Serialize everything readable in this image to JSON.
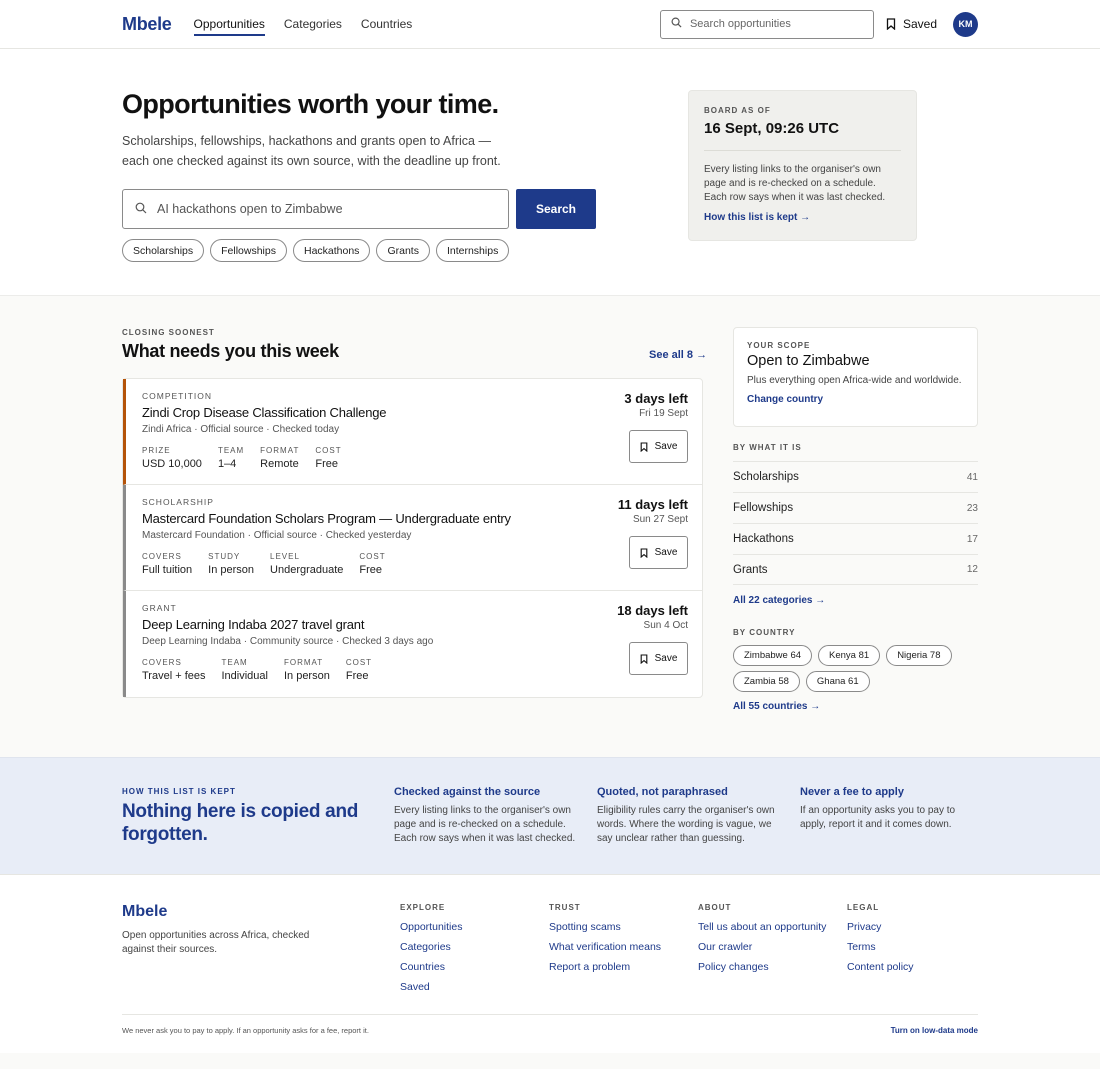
{
  "header": {
    "logo": "Mbele",
    "nav": [
      "Opportunities",
      "Categories",
      "Countries"
    ],
    "search_placeholder": "Search opportunities",
    "saved_label": "Saved",
    "avatar_initials": "KM"
  },
  "hero": {
    "title": "Opportunities worth your time.",
    "subtitle": "Scholarships, fellowships, hackathons and grants open to Africa — each one checked against its own source, with the deadline up front.",
    "search_placeholder": "AI hackathons open to Zimbabwe",
    "search_button": "Search",
    "chips": [
      "Scholarships",
      "Fellowships",
      "Hackathons",
      "Grants",
      "Internships"
    ]
  },
  "board": {
    "label": "BOARD AS OF",
    "value": "16 Sept, 09:26 UTC",
    "text": "Every listing links to the organiser's own page and is re-checked on a schedule. Each row says when it was last checked.",
    "link": "How this list is kept →"
  },
  "closing": {
    "eyebrow": "CLOSING SOONEST",
    "title": "What needs you this week",
    "see_all": "See all 8 →",
    "save_label": "Save",
    "cards": [
      {
        "type": "COMPETITION",
        "title": "Zindi Crop Disease Classification Challenge",
        "meta": "Zindi Africa · Official source · Checked today",
        "days": "3 days left",
        "date": "Fri 19 Sept",
        "facts": [
          {
            "k": "PRIZE",
            "v": "USD 10,000"
          },
          {
            "k": "TEAM",
            "v": "1–4"
          },
          {
            "k": "FORMAT",
            "v": "Remote"
          },
          {
            "k": "COST",
            "v": "Free"
          }
        ]
      },
      {
        "type": "SCHOLARSHIP",
        "title": "Mastercard Foundation Scholars Program — Undergraduate entry",
        "meta": "Mastercard Foundation · Official source · Checked yesterday",
        "days": "11 days left",
        "date": "Sun 27 Sept",
        "facts": [
          {
            "k": "COVERS",
            "v": "Full tuition"
          },
          {
            "k": "STUDY",
            "v": "In person"
          },
          {
            "k": "LEVEL",
            "v": "Undergraduate"
          },
          {
            "k": "COST",
            "v": "Free"
          }
        ]
      },
      {
        "type": "GRANT",
        "title": "Deep Learning Indaba 2027 travel grant",
        "meta": "Deep Learning Indaba · Community source · Checked 3 days ago",
        "days": "18 days left",
        "date": "Sun 4 Oct",
        "facts": [
          {
            "k": "COVERS",
            "v": "Travel + fees"
          },
          {
            "k": "TEAM",
            "v": "Individual"
          },
          {
            "k": "FORMAT",
            "v": "In person"
          },
          {
            "k": "COST",
            "v": "Free"
          }
        ]
      }
    ]
  },
  "scope": {
    "eyebrow": "YOUR SCOPE",
    "title": "Open to Zimbabwe",
    "desc": "Plus everything open Africa-wide and worldwide.",
    "link": "Change country"
  },
  "by_what": {
    "eyebrow": "BY WHAT IT IS",
    "rows": [
      {
        "name": "Scholarships",
        "count": "41"
      },
      {
        "name": "Fellowships",
        "count": "23"
      },
      {
        "name": "Hackathons",
        "count": "17"
      },
      {
        "name": "Grants",
        "count": "12"
      }
    ],
    "all_link": "All 22 categories →"
  },
  "by_country": {
    "eyebrow": "BY COUNTRY",
    "chips": [
      "Zimbabwe 64",
      "Kenya 81",
      "Nigeria 78",
      "Zambia 58",
      "Ghana 61"
    ],
    "all_link": "All 55 countries →"
  },
  "band": {
    "eyebrow": "HOW THIS LIST IS KEPT",
    "title": "Nothing here is copied and forgotten.",
    "cols": [
      {
        "t": "Checked against the source",
        "d": "Every listing links to the organiser's own page and is re-checked on a schedule. Each row says when it was last checked."
      },
      {
        "t": "Quoted, not paraphrased",
        "d": "Eligibility rules carry the organiser's own words. Where the wording is vague, we say unclear rather than guessing."
      },
      {
        "t": "Never a fee to apply",
        "d": "If an opportunity asks you to pay to apply, report it and it comes down."
      }
    ]
  },
  "footer": {
    "logo": "Mbele",
    "desc": "Open opportunities across Africa, checked against their sources.",
    "cols": [
      {
        "h": "EXPLORE",
        "links": [
          "Opportunities",
          "Categories",
          "Countries",
          "Saved"
        ]
      },
      {
        "h": "TRUST",
        "links": [
          "Spotting scams",
          "What verification means",
          "Report a problem"
        ]
      },
      {
        "h": "ABOUT",
        "links": [
          "Tell us about an opportunity",
          "Our crawler",
          "Policy changes"
        ]
      },
      {
        "h": "LEGAL",
        "links": [
          "Privacy",
          "Terms",
          "Content policy"
        ]
      }
    ],
    "note": "We never ask you to pay to apply. If an opportunity asks for a fee, report it.",
    "low_data": "Turn on low-data mode"
  },
  "colors": {
    "brand": "#1e3a8a",
    "urgent": "#b45309",
    "band": "#e8edf7"
  }
}
